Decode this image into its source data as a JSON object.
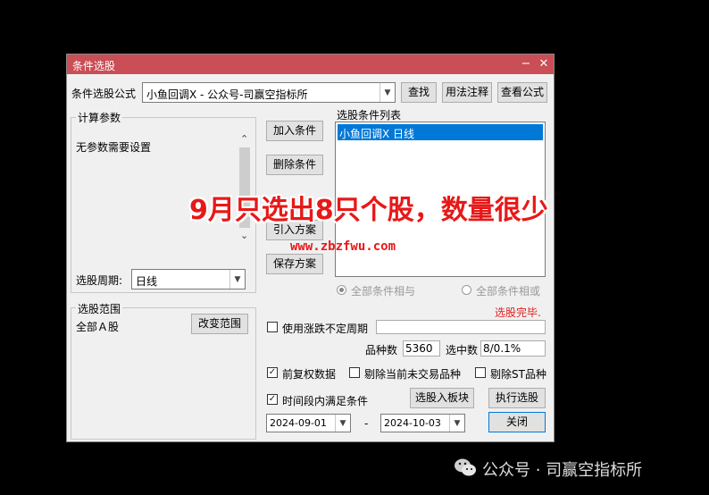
{
  "window": {
    "title": "条件选股",
    "minimize": "−",
    "close": "✕"
  },
  "formula": {
    "label": "条件选股公式",
    "value": "小鱼回调X  -  公众号-司赢空指标所",
    "buttons": {
      "find": "查找",
      "usage": "用法注释",
      "view": "查看公式"
    }
  },
  "params": {
    "group_label": "计算参数",
    "text": "无参数需要设置",
    "period_label": "选股周期:",
    "period_value": "日线"
  },
  "actions": {
    "add": "加入条件",
    "delete": "删除条件",
    "import": "引入方案",
    "save": "保存方案"
  },
  "condition_list": {
    "label": "选股条件列表",
    "items": [
      "小鱼回调X  日线"
    ]
  },
  "logic": {
    "and_label": "全部条件相与",
    "or_label": "全部条件相或",
    "selected": "and"
  },
  "status": "选股完毕.",
  "range": {
    "group_label": "选股范围",
    "value": "全部Ａ股",
    "change_button": "改变范围"
  },
  "options": {
    "variable_period_label": "使用涨跌不定周期",
    "variable_period_checked": false,
    "count_label": "品种数",
    "count_value": "5360",
    "selected_label": "选中数",
    "selected_value": "8/0.1%",
    "fq_label": "前复权数据",
    "fq_checked": true,
    "exclude_no_trade_label": "剔除当前未交易品种",
    "exclude_no_trade_checked": false,
    "exclude_st_label": "剔除ST品种",
    "exclude_st_checked": false,
    "time_range_label": "时间段内满足条件",
    "time_range_checked": true,
    "to_block_button": "选股入板块",
    "run_button": "执行选股",
    "date_from": "2024-09-01",
    "date_sep": "-",
    "date_to": "2024-10-03",
    "close_button": "关闭"
  },
  "overlay": {
    "headline": "9月只选出8只个股，数量很少",
    "url": "www.zbzfwu.com"
  },
  "watermark": {
    "text": "公众号 · 司赢空指标所"
  },
  "icons": {
    "check": "✓",
    "combo_arrow": "▼",
    "scroll_up": "⌃",
    "scroll_down": "⌄"
  }
}
